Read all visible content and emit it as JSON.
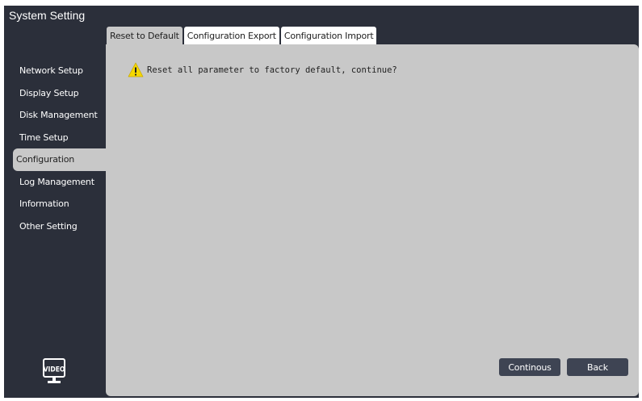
{
  "window": {
    "title": "System Setting"
  },
  "tabs": [
    {
      "label": "Reset to Default",
      "active": true
    },
    {
      "label": "Configuration Export",
      "active": false
    },
    {
      "label": "Configuration Import",
      "active": false
    }
  ],
  "sidebar": {
    "items": [
      {
        "label": "Network Setup"
      },
      {
        "label": "Display Setup"
      },
      {
        "label": "Disk Management"
      },
      {
        "label": "Time Setup"
      },
      {
        "label": "Configuration",
        "active": true
      },
      {
        "label": "Log Management"
      },
      {
        "label": "Information"
      },
      {
        "label": "Other Setting"
      }
    ],
    "logo_text": "VIDEO"
  },
  "content": {
    "warning_icon": "warning-triangle-icon",
    "message": "Reset all parameter to factory default, continue?"
  },
  "buttons": {
    "continue_label": "Continous",
    "back_label": "Back"
  },
  "colors": {
    "window_bg": "#2b2f3a",
    "panel_bg": "#c8c8c8",
    "button_bg": "#3e4453",
    "warning": "#f5d800"
  }
}
